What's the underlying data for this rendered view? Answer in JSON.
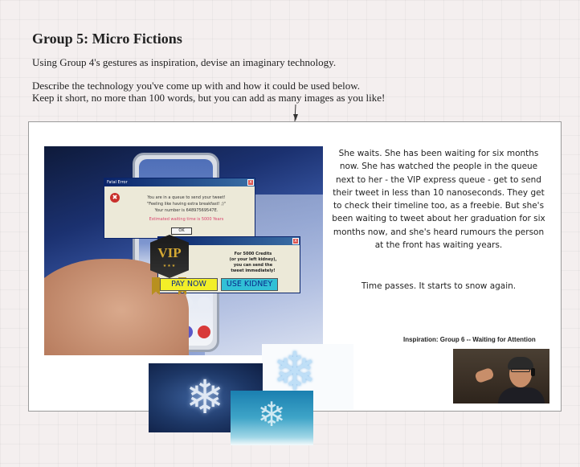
{
  "heading": "Group 5: Micro Fictions",
  "intro": {
    "line1": "Using Group 4's gestures as inspiration, devise an imaginary technology.",
    "line2": "Describe the technology you've come up with and how it could be used below.",
    "line3": "Keep it short, no more than 100 words, but you can add as many images as you like!"
  },
  "error_dialog": {
    "title": "Fatal Error",
    "close": "x",
    "line1": "You are in a queue to send your tweet!",
    "line2": "\"Feeling like having extra breakfast! ;)\"",
    "line3": "Your number is 64897569547E.",
    "line4": "Estimated waiting time is 5000 Years",
    "ok": "OK"
  },
  "vip_dialog": {
    "close": "x",
    "badge": "VIP",
    "stars": "★★★",
    "msg1": "For 5000 Credits",
    "msg2": "(or your left kidney),",
    "msg3": "you can send the",
    "msg4": "tweet immediately!",
    "pay_label": "PAY NOW",
    "kidney_label": "USE KIDNEY"
  },
  "story": {
    "para1": "She waits. She has been waiting for six months now. She has watched the people in the queue next to her - the VIP express queue - get to send their tweet in less than 10 nanoseconds. They get to check their timeline too, as a freebie. But she's been waiting to tweet about her graduation for six months now, and she's heard rumours the person at the front has waiting years.",
    "para2": "Time passes. It starts to snow again."
  },
  "caption": "Inspiration: Group 6 -- Waiting for Attention",
  "icons": {
    "snowflake": "❄",
    "error": "✖"
  },
  "colors": {
    "pay_button": "#f3ef28",
    "kidney_button": "#31c0d6",
    "button_text": "#0a2a8a",
    "waiting_time_text": "#d9436d"
  }
}
